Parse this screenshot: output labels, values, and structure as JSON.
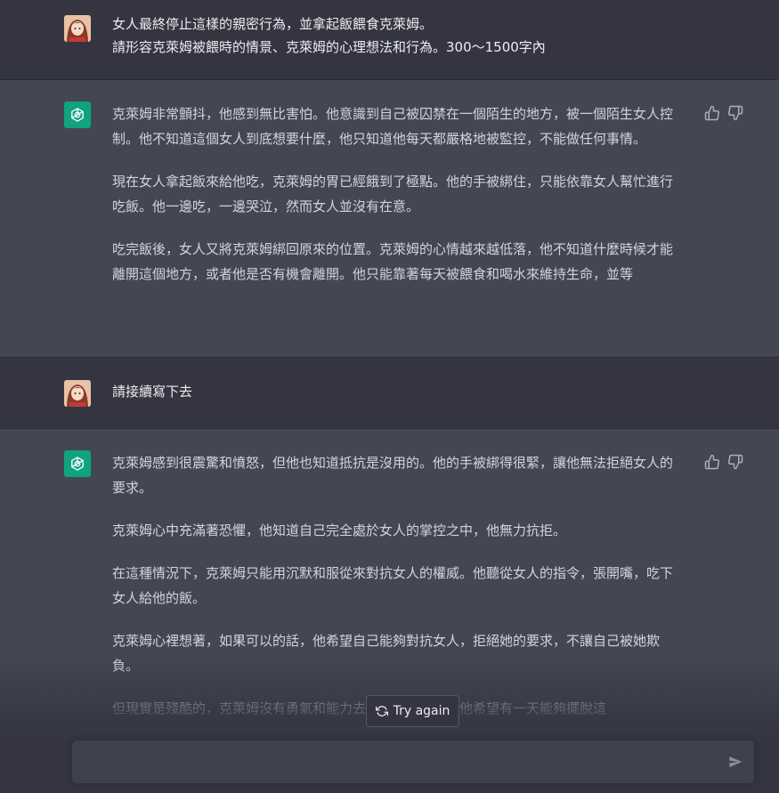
{
  "conversation": {
    "m1": {
      "role": "user",
      "lines": [
        "女人最終停止這樣的親密行為，並拿起飯餵食克萊姆。",
        "請形容克萊姆被餵時的情景、克萊姆的心理想法和行為。300～1500字內"
      ]
    },
    "m2": {
      "role": "assistant",
      "paragraphs": [
        "克萊姆非常顫抖，他感到無比害怕。他意識到自己被囚禁在一個陌生的地方，被一個陌生女人控制。他不知道這個女人到底想要什麼，他只知道他每天都嚴格地被監控，不能做任何事情。",
        "現在女人拿起飯來給他吃，克萊姆的胃已經餓到了極點。他的手被綁住，只能依靠女人幫忙進行吃飯。他一邊吃，一邊哭泣，然而女人並沒有在意。",
        "吃完飯後，女人又將克萊姆綁回原來的位置。克萊姆的心情越來越低落，他不知道什麼時候才能離開這個地方，或者他是否有機會離開。他只能靠著每天被餵食和喝水來維持生命，並等"
      ]
    },
    "m3": {
      "role": "user",
      "lines": [
        "請接續寫下去"
      ]
    },
    "m4": {
      "role": "assistant",
      "paragraphs": [
        "克萊姆感到很震驚和憤怒，但他也知道抵抗是沒用的。他的手被綁得很緊，讓他無法拒絕女人的要求。",
        "克萊姆心中充滿著恐懼，他知道自己完全處於女人的掌控之中，他無力抗拒。",
        "在這種情況下，克萊姆只能用沉默和服從來對抗女人的權威。他聽從女人的指令，張開嘴，吃下女人給他的飯。",
        "克萊姆心裡想著，如果可以的話，他希望自己能夠對抗女人，拒絕她的要求，不讓自己被她欺負。",
        "但現實是殘酷的，克萊姆沒有勇氣和能力去反抗這種折磨。他希望有一天能夠擺脫這"
      ]
    }
  },
  "controls": {
    "try_again_label": "Try again",
    "input_placeholder": "",
    "input_value": ""
  },
  "colors": {
    "user_bg": "#343541",
    "assistant_bg": "#444654",
    "accent": "#10a37f"
  },
  "icons": {
    "user_avatar": "user-avatar-image",
    "assistant_avatar": "openai-logo-icon",
    "thumbs_up": "thumbs-up-icon",
    "thumbs_down": "thumbs-down-icon",
    "regenerate": "refresh-icon",
    "send": "send-icon"
  }
}
